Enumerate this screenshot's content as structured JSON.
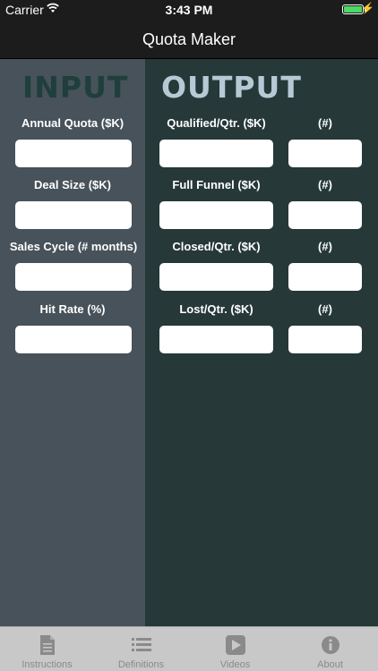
{
  "status": {
    "carrier": "Carrier",
    "time": "3:43 PM"
  },
  "nav": {
    "title": "Quota Maker"
  },
  "input": {
    "heading": "INPUT",
    "fields": [
      {
        "label": "Annual Quota ($K)",
        "value": ""
      },
      {
        "label": "Deal Size ($K)",
        "value": ""
      },
      {
        "label": "Sales Cycle (# months)",
        "value": ""
      },
      {
        "label": "Hit Rate (%)",
        "value": ""
      }
    ]
  },
  "output": {
    "heading": "OUTPUT",
    "rows": [
      {
        "label": "Qualified/Qtr. ($K)",
        "count_label": "(#)",
        "value": "",
        "count": ""
      },
      {
        "label": "Full Funnel ($K)",
        "count_label": "(#)",
        "value": "",
        "count": ""
      },
      {
        "label": "Closed/Qtr. ($K)",
        "count_label": "(#)",
        "value": "",
        "count": ""
      },
      {
        "label": "Lost/Qtr. ($K)",
        "count_label": "(#)",
        "value": "",
        "count": ""
      }
    ]
  },
  "tabs": [
    {
      "label": "Instructions",
      "icon": "document-icon"
    },
    {
      "label": "Definitions",
      "icon": "list-icon"
    },
    {
      "label": "Videos",
      "icon": "youtube-icon"
    },
    {
      "label": "About",
      "icon": "info-icon"
    }
  ]
}
